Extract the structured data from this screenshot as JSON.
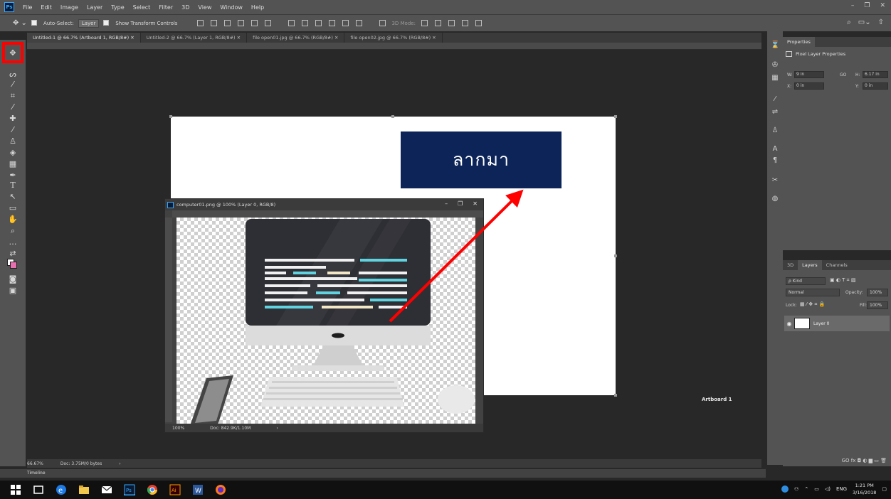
{
  "menubar": {
    "items": [
      "File",
      "Edit",
      "Image",
      "Layer",
      "Type",
      "Select",
      "Filter",
      "3D",
      "View",
      "Window",
      "Help"
    ],
    "app_icon": "Ps",
    "window_controls": [
      "–",
      "❐",
      "✕"
    ]
  },
  "options_bar": {
    "auto_select_label": "Auto-Select:",
    "auto_select_target": "Layer",
    "show_transform_label": "Show Transform Controls",
    "mode_label": "3D Mode:"
  },
  "doc_tabs": [
    "Untitled-1 @ 66.7% (Artboard 1, RGB/8#)",
    "Untitled-2 @ 66.7% (Layer 1, RGB/8#)",
    "file open01.jpg @ 66.7% (RGB/8#)",
    "file open02.jpg @ 66.7% (RGB/8#)"
  ],
  "tab_close_glyph": "✕",
  "canvas": {
    "drag_label": "ลากมา",
    "artboard_label": "Artboard 1"
  },
  "floating_window": {
    "title": "computer01.png @ 100% (Layer 0, RGB/8)",
    "zoom": "100%",
    "doc_size": "Doc: 842.9K/1.10M",
    "status_arrow": "›"
  },
  "properties": {
    "tab": "Properties",
    "header": "Pixel Layer Properties",
    "w_label": "W:",
    "w_value": "9 in",
    "link_glyph": "GO",
    "h_label": "H:",
    "h_value": "6.17 in",
    "x_label": "X:",
    "x_value": "0 in",
    "y_label": "Y:",
    "y_value": "0 in"
  },
  "layers": {
    "tabs": [
      "3D",
      "Layers",
      "Channels"
    ],
    "kind": "ρ Kind",
    "blend_mode": "Normal",
    "opacity_label": "Opacity:",
    "opacity_value": "100%",
    "lock_label": "Lock:",
    "fill_label": "Fill:",
    "fill_value": "100%",
    "layer_name": "Layer 0",
    "bottom_icons": "GO  fx  ◘  ◐  ▆  ▭  🗑"
  },
  "status_bar": {
    "zoom": "66.67%",
    "doc_size": "Doc: 3.75M/0 bytes",
    "arrow": "›"
  },
  "timeline": {
    "label": "Timeline"
  },
  "taskbar": {
    "lang": "ENG",
    "time": "1:21 PM",
    "date": "3/16/2018"
  },
  "colors": {
    "drag_label_bg": "#0c2458",
    "highlight": "#ff0000",
    "arrow": "#ff0000",
    "ps_blue": "#31a8ff"
  }
}
